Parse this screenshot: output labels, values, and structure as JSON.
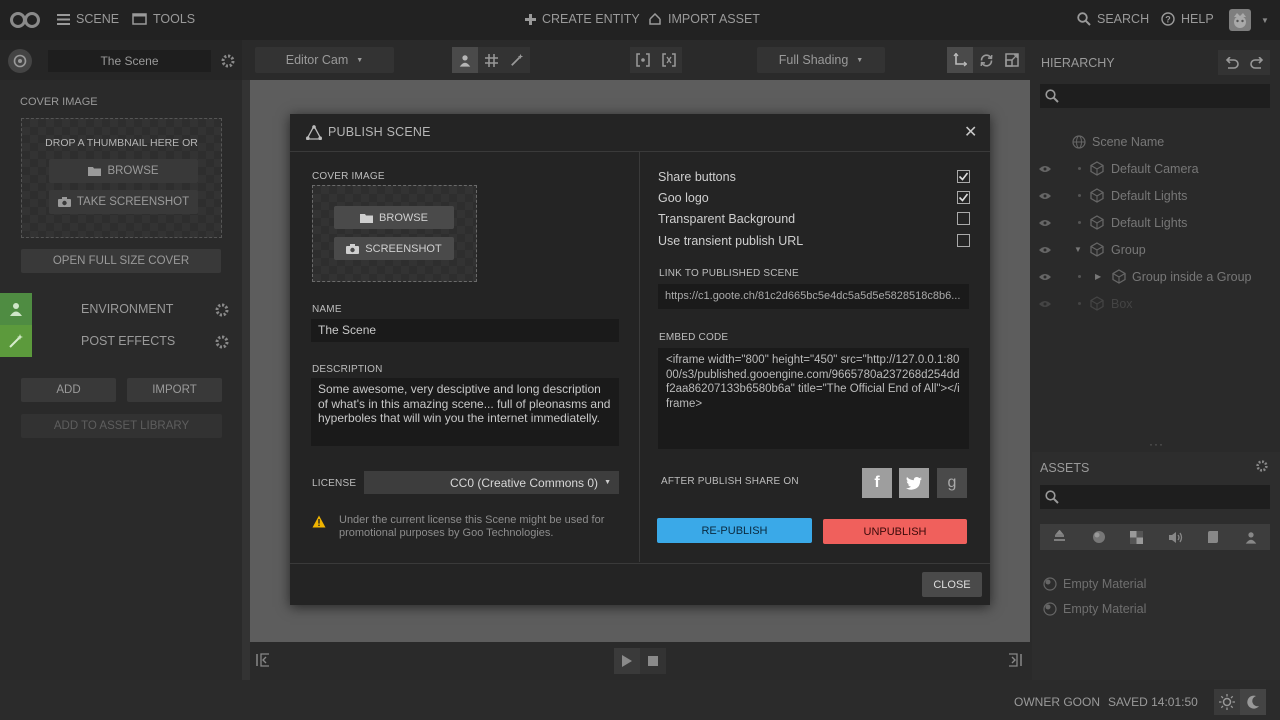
{
  "topbar": {
    "scene_label": "SCENE",
    "tools_label": "TOOLS",
    "create_entity_label": "CREATE ENTITY",
    "import_asset_label": "IMPORT ASSET",
    "search_label": "SEARCH",
    "help_label": "HELP"
  },
  "left_panel": {
    "scene_name": "The Scene",
    "cover_image_label": "COVER IMAGE",
    "drop_text": "DROP A THUMBNAIL HERE OR",
    "browse_label": "BROWSE",
    "take_screenshot_label": "TAKE SCREENSHOT",
    "open_full_size_label": "OPEN FULL SIZE COVER",
    "environment_label": "ENVIRONMENT",
    "post_effects_label": "POST EFFECTS",
    "add_label": "ADD",
    "import_label": "IMPORT",
    "add_to_library_label": "ADD TO ASSET LIBRARY"
  },
  "viewport": {
    "camera_select": "Editor Cam",
    "shading_select": "Full Shading"
  },
  "hierarchy": {
    "title": "HIERARCHY",
    "items": [
      {
        "label": "Scene Name"
      },
      {
        "label": "Default Camera"
      },
      {
        "label": "Default Lights"
      },
      {
        "label": "Default Lights"
      },
      {
        "label": "Group"
      },
      {
        "label": "Group inside a Group"
      },
      {
        "label": "Box"
      }
    ]
  },
  "assets": {
    "title": "ASSETS",
    "items": [
      {
        "label": "Empty Material"
      },
      {
        "label": "Empty Material"
      }
    ]
  },
  "status": {
    "owner": "OWNER GOON",
    "saved": "SAVED 14:01:50"
  },
  "modal": {
    "title": "PUBLISH SCENE",
    "cover_image_label": "COVER IMAGE",
    "browse_label": "BROWSE",
    "screenshot_label": "SCREENSHOT",
    "name_label": "NAME",
    "name_value": "The Scene",
    "description_label": "DESCRIPTION",
    "description_value": "Some awesome, very desciptive and long description of what's in this amazing scene... full of pleonasms and hyperboles that will win you the internet immediatelly.",
    "license_label": "LICENSE",
    "license_value": "CC0 (Creative Commons 0)",
    "license_note": "Under the current license this Scene might be used for promotional purposes by Goo Technologies.",
    "options": [
      {
        "label": "Share buttons",
        "checked": true
      },
      {
        "label": "Goo logo",
        "checked": true
      },
      {
        "label": "Transparent Background",
        "checked": false
      },
      {
        "label": "Use transient publish URL",
        "checked": false
      }
    ],
    "link_label": "LINK TO PUBLISHED SCENE",
    "link_value": "https://c1.goote.ch/81c2d665bc5e4dc5a5d5e5828518c8b6...",
    "embed_label": "EMBED CODE",
    "embed_value": "<iframe width=\"800\" height=\"450\" src=\"http://127.0.0.1:8000/s3/published.gooengine.com/9665780a237268d254ddf2aa86207133b6580b6a\" title=\"The Official End of All\"></iframe>",
    "share_label": "AFTER PUBLISH SHARE ON",
    "share_glyphs": {
      "facebook": "f",
      "google": "g"
    },
    "republish_label": "RE-PUBLISH",
    "unpublish_label": "UNPUBLISH",
    "close_label": "CLOSE",
    "colors": {
      "republish": "#3aa9e8",
      "unpublish": "#f0605c",
      "warning": "#f0b400"
    }
  }
}
